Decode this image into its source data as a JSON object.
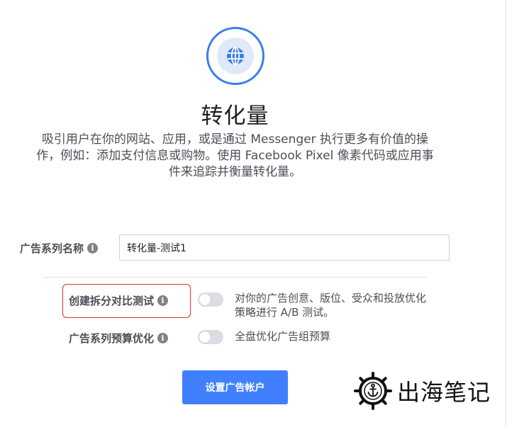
{
  "objective": {
    "icon": "globe-icon",
    "title": "转化量",
    "description": [
      "吸引用户在你的网站、应用，或是通过 Messenger 执行更多有价值的操",
      "作，例如：添加支付信息或购物。使用 Facebook Pixel 像素代码或应用事",
      "件来追踪并衡量转化量。"
    ]
  },
  "campaign_name": {
    "label": "广告系列名称",
    "value": "转化量-测试1"
  },
  "split_test": {
    "label": "创建拆分对比测试",
    "enabled": false,
    "description": [
      "对你的广告创意、版位、受众和投放优化",
      "策略进行 A/B 测试。"
    ]
  },
  "budget_optimization": {
    "label": "广告系列预算优化",
    "enabled": false,
    "description": "全盘优化广告组预算"
  },
  "primary_button": {
    "label": "设置广告帐户"
  },
  "watermark": {
    "icon": "ship-wheel-anchor-icon",
    "text": "出海笔记"
  },
  "colors": {
    "accent": "#4080ff",
    "highlight": "#e0302b"
  }
}
